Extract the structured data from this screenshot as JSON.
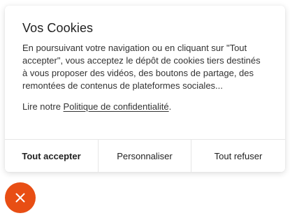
{
  "cookie_banner": {
    "title": "Vos Cookies",
    "description": "En poursuivant votre navigation ou en cliquant sur \"Tout accepter\", vous acceptez le dépôt de cookies tiers destinés à vous proposer des vidéos, des boutons de partage, des remontées de contenus de plateformes sociales...",
    "privacy_prefix": "Lire notre ",
    "privacy_link": "Politique de confidentialité",
    "privacy_suffix": ".",
    "buttons": {
      "accept": "Tout accepter",
      "customize": "Personnaliser",
      "refuse": "Tout refuser"
    }
  },
  "close_button": {
    "icon": "close-icon",
    "color": "#e84e14"
  }
}
